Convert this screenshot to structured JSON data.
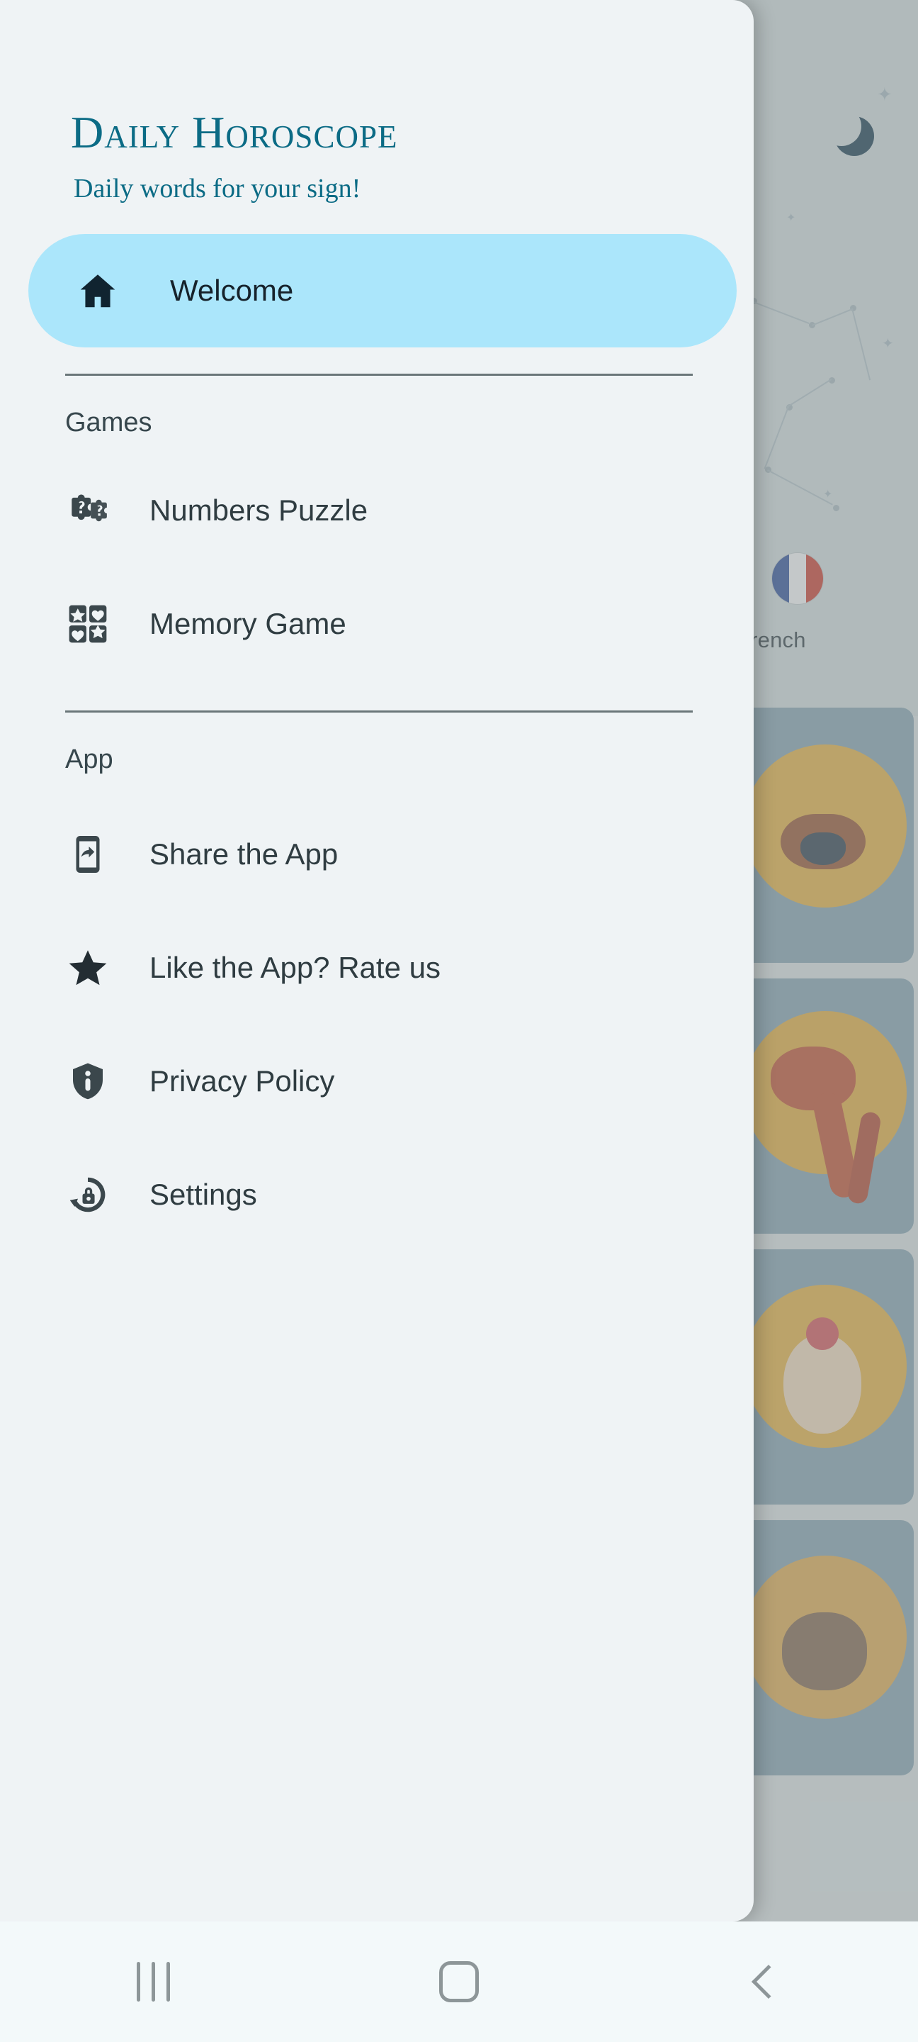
{
  "app": {
    "title": "Daily Horoscope",
    "subtitle": "Daily words for your sign!"
  },
  "drawer": {
    "active_item": {
      "label": "Welcome",
      "icon": "home-icon",
      "highlight_color": "#abe6fb",
      "text_color": "#16222b"
    },
    "sections": [
      {
        "label": "Games",
        "items": [
          {
            "label": "Numbers Puzzle",
            "icon": "puzzle-question-icon"
          },
          {
            "label": "Memory Game",
            "icon": "memory-cards-icon"
          }
        ]
      },
      {
        "label": "App",
        "items": [
          {
            "label": "Share the App",
            "icon": "share-phone-icon"
          },
          {
            "label": "Like the App? Rate us",
            "icon": "star-icon"
          },
          {
            "label": "Privacy Policy",
            "icon": "shield-info-icon"
          },
          {
            "label": "Settings",
            "icon": "privacy-lock-icon"
          }
        ]
      }
    ]
  },
  "background": {
    "language_label": "French",
    "flag": "french-flag-icon"
  },
  "navbar": {
    "recents_label": "Recents",
    "home_label": "Home",
    "back_label": "Back"
  },
  "colors": {
    "drawer_bg": "#eff3f5",
    "brand_teal": "#0b6b85",
    "highlight": "#abe6fb",
    "icon_dark": "#3b474c",
    "divider": "#6a7679"
  }
}
